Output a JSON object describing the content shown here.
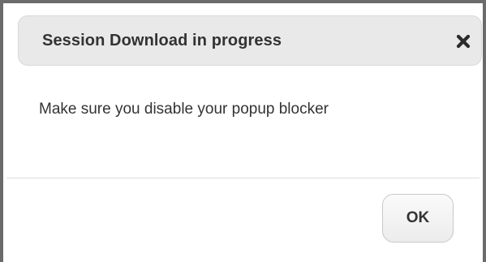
{
  "dialog": {
    "title": "Session Download in progress",
    "close_icon": "close-icon",
    "message": "Make sure you disable your popup blocker",
    "ok_label": "OK"
  },
  "colors": {
    "frame_border": "#6b6b6b",
    "header_background": "#e9e9e9",
    "text": "#333333",
    "button_background": "#f2f2f2"
  }
}
